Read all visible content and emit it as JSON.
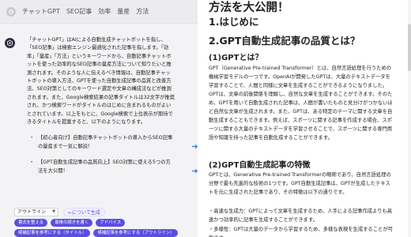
{
  "chat": {
    "topbar_text": "チャットGPT　SEO記事　効率　量産　方法",
    "paragraph": "「チャットGPT」はAIによる自動生成チャットボットを指し、「SEO記事」は検索エンジン最適化された記事を指します。「効率」「量産」「方法」というキーワードから、自動記事チャットボットを使った効率的なSEO記事の量産方法について知りたいと推測されます。そのような人に伝えるべき情報は、自動記事チャットボットの導入方法、GPTを使った自動生成記事の品質と改善方法、SEO対策としてのキーワード選定や文章の構成法などが推測されます。また、Google検索結果の記事タイトルは32文字が推奨され、かつ検索ワードがタイトルのはじめに含まれるものがよいとされています。以上をもとに、Google検索で上位表示が期待できるタイトルを提案すると、以下のようになります。",
    "bullets": [
      "【初心者向け】自動記事チャットボットの導入からSEO記事の量産まで一気に解説！",
      "【GPT自動生成記事の品質向上】SEO対策に使える5つの方法を大公開！"
    ]
  },
  "controls": {
    "select_value": "アウトライン",
    "generate_label": "←について生成"
  },
  "chips": [
    "書式を整える",
    "最後の続きを書く",
    "アドバイス",
    "候補記事を参考にする（タイトル）",
    "候補記事を参考にする（アウトライン）"
  ],
  "article": {
    "h1": "方法を大公開！",
    "h2_intro": "1.はじめに",
    "h2_quality": "2.GPT自動生成記事の品質とは？",
    "h3_gpt": "(1)GPTとは？",
    "p_gpt": "GPT（Generative Pre-trained Transformer）とは、自然言語処理を行うための機械学習モデルの一つです。OpenAIが開発したGPTは、大量のテキストデータを学習することで、人間と同様に文章を生成することができるようになりました。GPTは、文章の前後関係を理解し、自然な文章を生成することができます。そのため、GPTを用いて自動生成された記事は、人間が書いたものと見分けがつかないほど自然な文章が生成されます。また、GPTは、ある特定のテーマに関する文章を自動生成することもできます。例えば、スポーツに関する記事を作成する場合、スポーツに関する大量のテキストデータを学習させることで、スポーツに関する専門用語や知識を持った記事を自動生成することができます。",
    "h3_feature": "(2)GPT自動生成記事の特徴",
    "p_feature": "GPTとは、Generative Pre-trained Transformerの略称であり、自然言語処理の分野で最も先進的な技術の1つです。GPT自動生成記事は、GPTが生成したテキストを元に生成された記事であり、その特徴は以下の通りです。",
    "p_feature_1": "・高速な生成力：GPTによって文章を生成するため、人手による記事作成よりも高速かつ効率的に記事を生成することができます。",
    "p_feature_2": "・多様性：GPTは大量のデータから学習するため、多様な表現を生成することが可能です。"
  }
}
